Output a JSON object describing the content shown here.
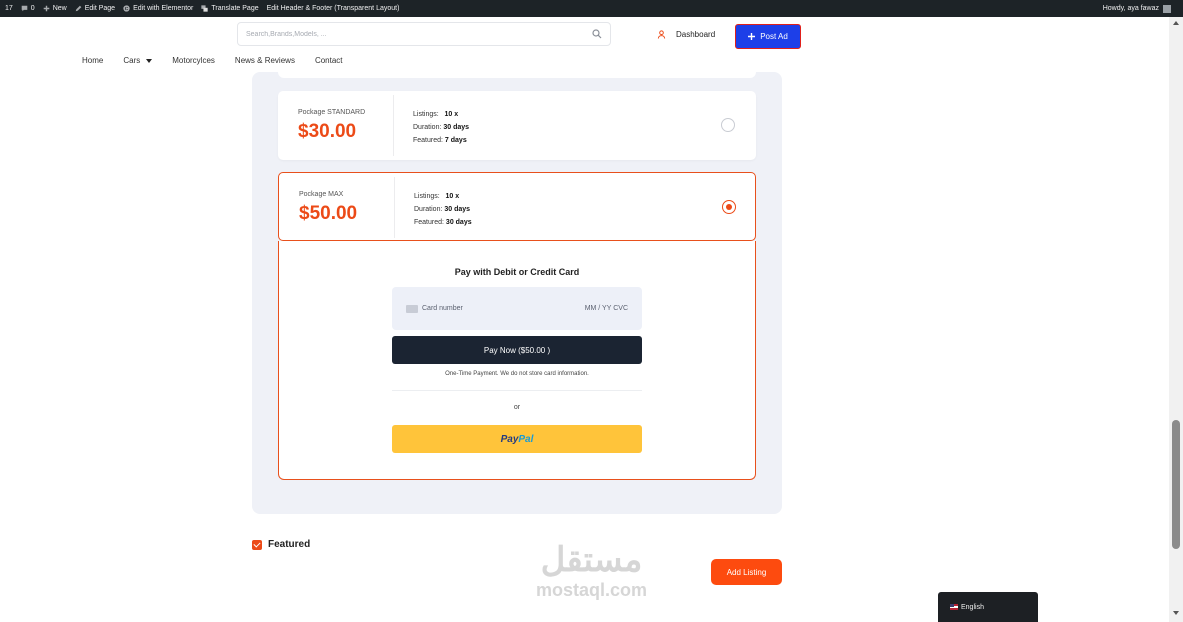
{
  "adminbar": {
    "count": "17",
    "comments": "0",
    "new_label": "New",
    "edit_page": "Edit Page",
    "elementor": "Edit with Elementor",
    "translate": "Translate Page",
    "header_footer": "Edit Header & Footer (Transparent Layout)",
    "howdy": "Howdy, aya fawaz"
  },
  "header": {
    "search_placeholder": "Search,Brands,Models, ...",
    "dashboard": "Dashboard",
    "post_ad": "Post Ad"
  },
  "nav": {
    "items": [
      "Home",
      "Cars",
      "Motorcylces",
      "News & Reviews",
      "Contact"
    ]
  },
  "packages": [
    {
      "name": "Pockage STANDARD",
      "price": "$30.00",
      "listings_label": "Listings:",
      "listings": "10 x",
      "duration_label": "Duration:",
      "duration": "30 days",
      "featured_label": "Featured:",
      "featured": "7 days",
      "selected": false
    },
    {
      "name": "Pockage MAX",
      "price": "$50.00",
      "listings_label": "Listings:",
      "listings": "10 x",
      "duration_label": "Duration:",
      "duration": "30 days",
      "featured_label": "Featured:",
      "featured": "30 days",
      "selected": true
    }
  ],
  "payment": {
    "title": "Pay with Debit or Credit Card",
    "card_placeholder": "Card number",
    "expiry_cvc": "MM / YY  CVC",
    "pay_now": "Pay Now ($50.00 )",
    "note": "One-Time Payment. We do not store card information.",
    "or": "or",
    "paypal_part1": "Pay",
    "paypal_part2": "Pal"
  },
  "featured_label": "Featured",
  "featured_checked": true,
  "add_listing": "Add Listing",
  "watermark": {
    "arabic": "مستقل",
    "latin": "mostaql.com"
  },
  "language": "English",
  "colors": {
    "accent": "#ec4a17",
    "post_ad_bg": "#1d3fe8",
    "pay_now_bg": "#1b2432",
    "paypal_bg": "#ffc43a"
  }
}
